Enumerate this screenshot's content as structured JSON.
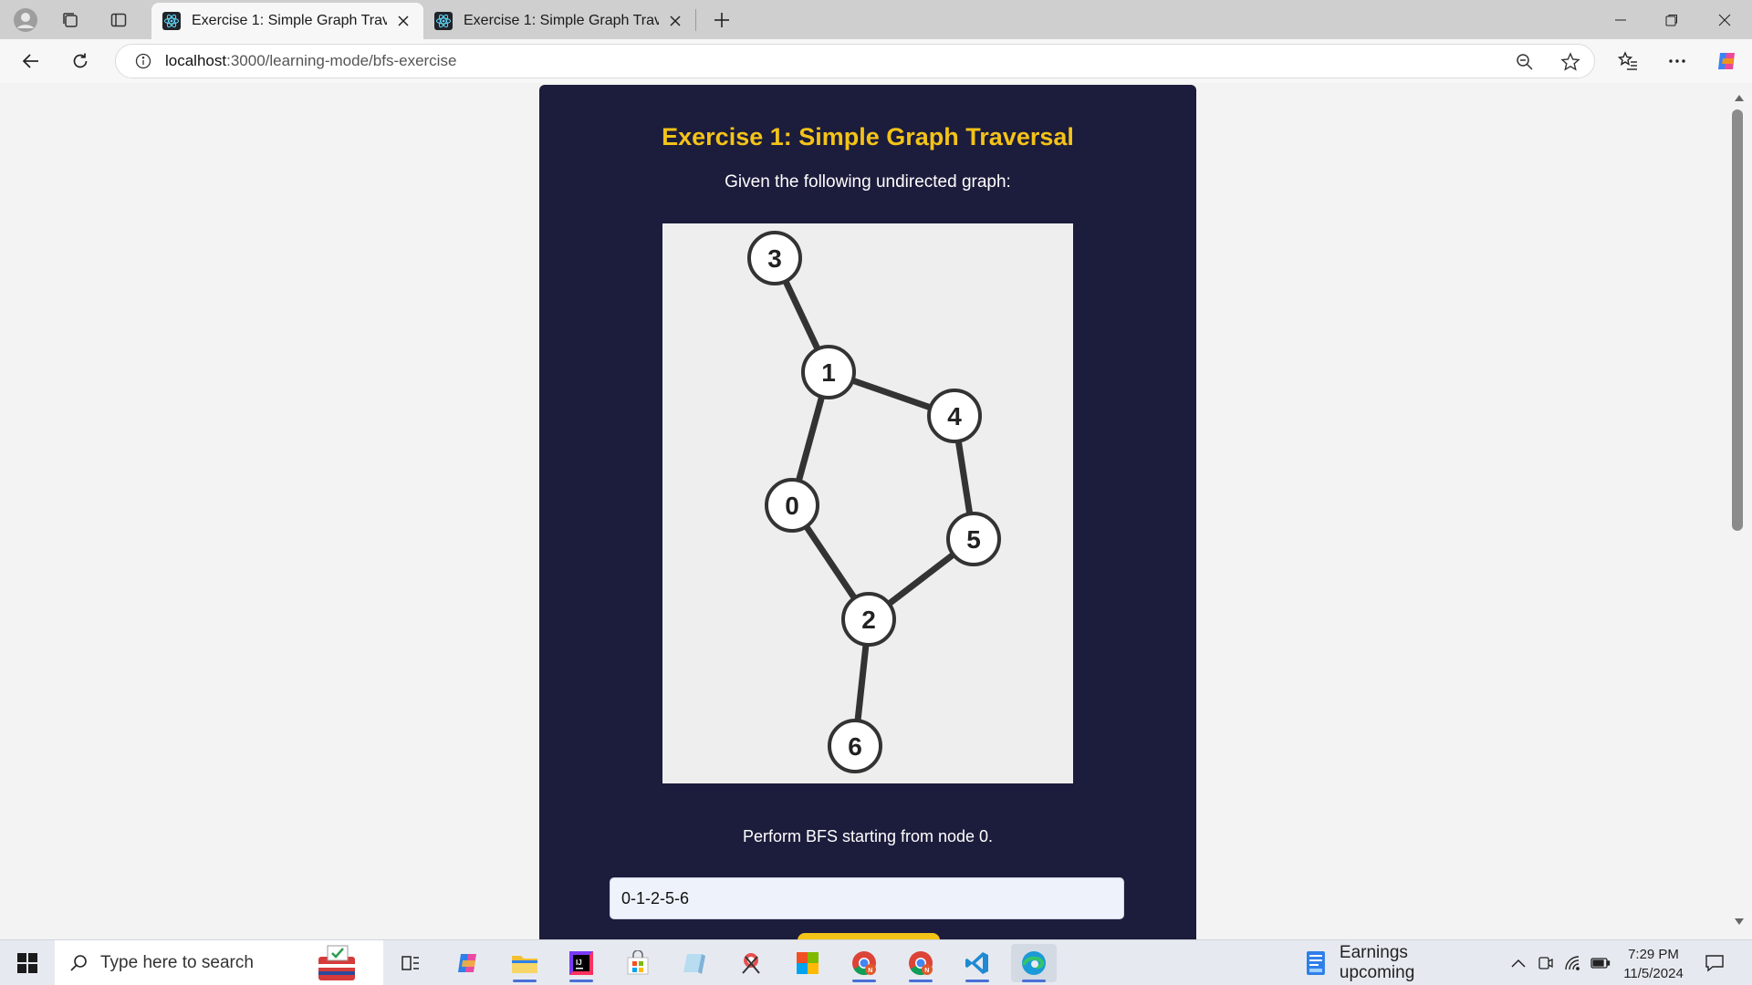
{
  "browser": {
    "tabs": [
      {
        "title": "Exercise 1: Simple Graph Traversal",
        "active": true
      },
      {
        "title": "Exercise 1: Simple Graph Traversal",
        "active": false
      }
    ],
    "url_host": "localhost",
    "url_path": ":3000/learning-mode/bfs-exercise"
  },
  "exercise": {
    "title": "Exercise 1: Simple Graph Traversal",
    "subtitle": "Given the following undirected graph:",
    "instruction": "Perform BFS starting from node 0.",
    "answer_value": "0-1-2-5-6"
  },
  "graph": {
    "nodes": [
      {
        "id": "0",
        "label": "0"
      },
      {
        "id": "1",
        "label": "1"
      },
      {
        "id": "2",
        "label": "2"
      },
      {
        "id": "3",
        "label": "3"
      },
      {
        "id": "4",
        "label": "4"
      },
      {
        "id": "5",
        "label": "5"
      },
      {
        "id": "6",
        "label": "6"
      }
    ],
    "edges": [
      [
        "3",
        "1"
      ],
      [
        "1",
        "4"
      ],
      [
        "1",
        "0"
      ],
      [
        "4",
        "5"
      ],
      [
        "0",
        "2"
      ],
      [
        "5",
        "2"
      ],
      [
        "2",
        "6"
      ]
    ]
  },
  "taskbar": {
    "search_placeholder": "Type here to search",
    "news_label": "Earnings upcoming",
    "time": "7:29 PM",
    "date": "11/5/2024"
  },
  "colors": {
    "card_bg": "#1c1c3c",
    "title_accent": "#f3c318",
    "graph_bg": "#eeeeee"
  }
}
